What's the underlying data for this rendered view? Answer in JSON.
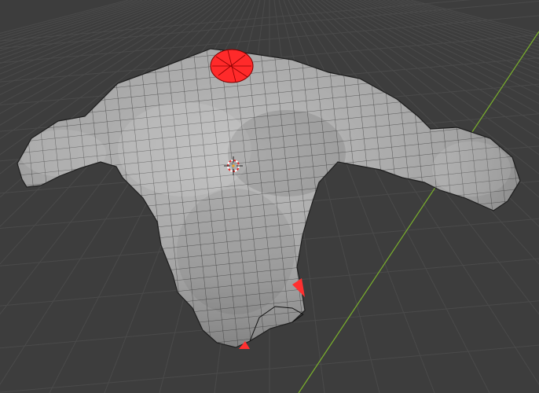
{
  "viewport": {
    "background_color": "#3d3d3d",
    "grid_color": "#4a4a4a",
    "y_axis_color": "#7ab02c",
    "mesh_fill_color": "#a9a9a9",
    "mesh_wire_color": "#1e1e1e",
    "selection_color": "#ff2a2a",
    "cursor_icon": "3d-cursor-icon"
  },
  "object": {
    "type": "mesh",
    "shape": "torso",
    "selected_faces": [
      "neck-opening",
      "side-edge",
      "bottom-edge"
    ]
  }
}
